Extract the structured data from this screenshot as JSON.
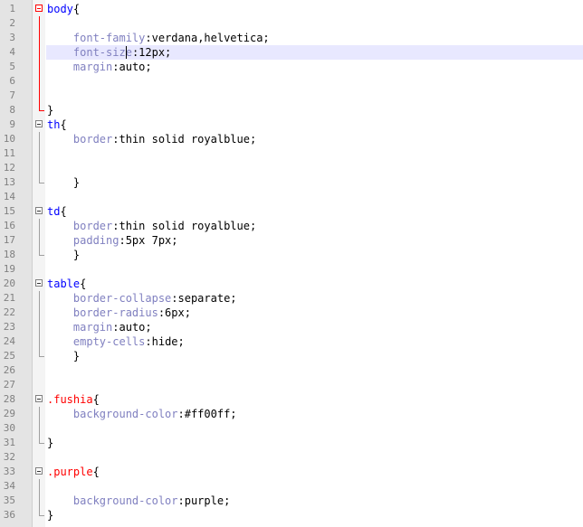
{
  "editor": {
    "current_line": 4,
    "caret": {
      "line": 4,
      "col": 12
    },
    "colors": {
      "selector": "#0000ff",
      "class_selector": "#ff0000",
      "property": "#8080c0",
      "value": "#000000",
      "current_line_bg": "#e8e8ff",
      "gutter_bg": "#e4e4e4",
      "active_fold": "#ff0000"
    },
    "lines": [
      {
        "n": "1",
        "tokens": [
          {
            "t": "body",
            "k": "sel"
          },
          {
            "t": "{",
            "k": "punct"
          }
        ],
        "fold": "start",
        "active": true
      },
      {
        "n": "2",
        "tokens": [],
        "fold": "line",
        "active": true
      },
      {
        "n": "3",
        "tokens": [
          {
            "t": "    ",
            "k": "ind"
          },
          {
            "t": "font-family",
            "k": "prop"
          },
          {
            "t": ":verdana,helvetica;",
            "k": "val"
          }
        ],
        "fold": "line",
        "active": true
      },
      {
        "n": "4",
        "tokens": [
          {
            "t": "    ",
            "k": "ind"
          },
          {
            "t": "font-size",
            "k": "prop"
          },
          {
            "t": ":12px;",
            "k": "val"
          }
        ],
        "fold": "line",
        "active": true
      },
      {
        "n": "5",
        "tokens": [
          {
            "t": "    ",
            "k": "ind"
          },
          {
            "t": "margin",
            "k": "prop"
          },
          {
            "t": ":auto;",
            "k": "val"
          }
        ],
        "fold": "line",
        "active": true
      },
      {
        "n": "6",
        "tokens": [],
        "fold": "line",
        "active": true
      },
      {
        "n": "7",
        "tokens": [],
        "fold": "line",
        "active": true
      },
      {
        "n": "8",
        "tokens": [
          {
            "t": "}",
            "k": "punct"
          }
        ],
        "fold": "end",
        "active": true
      },
      {
        "n": "9",
        "tokens": [
          {
            "t": "th",
            "k": "sel"
          },
          {
            "t": "{",
            "k": "punct"
          }
        ],
        "fold": "start",
        "active": false
      },
      {
        "n": "10",
        "tokens": [
          {
            "t": "    ",
            "k": "ind"
          },
          {
            "t": "border",
            "k": "prop"
          },
          {
            "t": ":thin solid royalblue;",
            "k": "val"
          }
        ],
        "fold": "line",
        "active": false
      },
      {
        "n": "11",
        "tokens": [],
        "fold": "line",
        "active": false
      },
      {
        "n": "12",
        "tokens": [],
        "fold": "line",
        "active": false
      },
      {
        "n": "13",
        "tokens": [
          {
            "t": "    ",
            "k": "ind"
          },
          {
            "t": "}",
            "k": "punct"
          }
        ],
        "fold": "end",
        "active": false
      },
      {
        "n": "14",
        "tokens": [],
        "fold": "none",
        "active": false
      },
      {
        "n": "15",
        "tokens": [
          {
            "t": "td",
            "k": "sel"
          },
          {
            "t": "{",
            "k": "punct"
          }
        ],
        "fold": "start",
        "active": false
      },
      {
        "n": "16",
        "tokens": [
          {
            "t": "    ",
            "k": "ind"
          },
          {
            "t": "border",
            "k": "prop"
          },
          {
            "t": ":thin solid royalblue;",
            "k": "val"
          }
        ],
        "fold": "line",
        "active": false
      },
      {
        "n": "17",
        "tokens": [
          {
            "t": "    ",
            "k": "ind"
          },
          {
            "t": "padding",
            "k": "prop"
          },
          {
            "t": ":5px 7px;",
            "k": "val"
          }
        ],
        "fold": "line",
        "active": false
      },
      {
        "n": "18",
        "tokens": [
          {
            "t": "    ",
            "k": "ind"
          },
          {
            "t": "}",
            "k": "punct"
          }
        ],
        "fold": "end",
        "active": false
      },
      {
        "n": "19",
        "tokens": [],
        "fold": "none",
        "active": false
      },
      {
        "n": "20",
        "tokens": [
          {
            "t": "table",
            "k": "sel"
          },
          {
            "t": "{",
            "k": "punct"
          }
        ],
        "fold": "start",
        "active": false
      },
      {
        "n": "21",
        "tokens": [
          {
            "t": "    ",
            "k": "ind"
          },
          {
            "t": "border-collapse",
            "k": "prop"
          },
          {
            "t": ":separate;",
            "k": "val"
          }
        ],
        "fold": "line",
        "active": false
      },
      {
        "n": "22",
        "tokens": [
          {
            "t": "    ",
            "k": "ind"
          },
          {
            "t": "border-radius",
            "k": "prop"
          },
          {
            "t": ":6px;",
            "k": "val"
          }
        ],
        "fold": "line",
        "active": false
      },
      {
        "n": "23",
        "tokens": [
          {
            "t": "    ",
            "k": "ind"
          },
          {
            "t": "margin",
            "k": "prop"
          },
          {
            "t": ":auto;",
            "k": "val"
          }
        ],
        "fold": "line",
        "active": false
      },
      {
        "n": "24",
        "tokens": [
          {
            "t": "    ",
            "k": "ind"
          },
          {
            "t": "empty-cells",
            "k": "prop"
          },
          {
            "t": ":hide;",
            "k": "val"
          }
        ],
        "fold": "line",
        "active": false
      },
      {
        "n": "25",
        "tokens": [
          {
            "t": "    ",
            "k": "ind"
          },
          {
            "t": "}",
            "k": "punct"
          }
        ],
        "fold": "end",
        "active": false
      },
      {
        "n": "26",
        "tokens": [],
        "fold": "none",
        "active": false
      },
      {
        "n": "27",
        "tokens": [],
        "fold": "none",
        "active": false
      },
      {
        "n": "28",
        "tokens": [
          {
            "t": ".fushia",
            "k": "cls"
          },
          {
            "t": "{",
            "k": "punct"
          }
        ],
        "fold": "start",
        "active": false
      },
      {
        "n": "29",
        "tokens": [
          {
            "t": "    ",
            "k": "ind"
          },
          {
            "t": "background-color",
            "k": "prop"
          },
          {
            "t": ":#ff00ff;",
            "k": "val"
          }
        ],
        "fold": "line",
        "active": false
      },
      {
        "n": "30",
        "tokens": [],
        "fold": "line",
        "active": false
      },
      {
        "n": "31",
        "tokens": [
          {
            "t": "}",
            "k": "punct"
          }
        ],
        "fold": "end",
        "active": false
      },
      {
        "n": "32",
        "tokens": [],
        "fold": "none",
        "active": false
      },
      {
        "n": "33",
        "tokens": [
          {
            "t": ".purple",
            "k": "cls"
          },
          {
            "t": "{",
            "k": "punct"
          }
        ],
        "fold": "start",
        "active": false
      },
      {
        "n": "34",
        "tokens": [],
        "fold": "line",
        "active": false
      },
      {
        "n": "35",
        "tokens": [
          {
            "t": "    ",
            "k": "ind"
          },
          {
            "t": "background-color",
            "k": "prop"
          },
          {
            "t": ":purple;",
            "k": "val"
          }
        ],
        "fold": "line",
        "active": false
      },
      {
        "n": "36",
        "tokens": [
          {
            "t": "}",
            "k": "punct"
          }
        ],
        "fold": "end",
        "active": false
      }
    ]
  }
}
